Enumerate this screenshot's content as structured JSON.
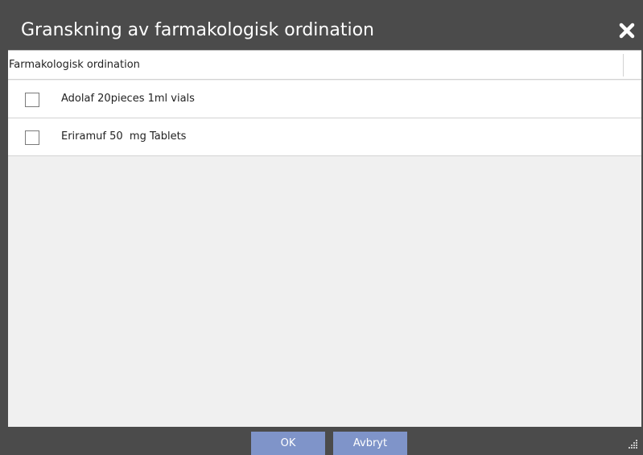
{
  "dialog": {
    "title": "Granskning av farmakologisk ordination",
    "close_icon": "close-icon"
  },
  "table": {
    "column_header": "Farmakologisk ordination",
    "rows": [
      {
        "label": "Adolaf 20pieces 1ml vials",
        "checked": false
      },
      {
        "label": "Eriramuf 50  mg Tablets",
        "checked": false
      }
    ]
  },
  "footer": {
    "ok_label": "OK",
    "cancel_label": "Avbryt",
    "resize_icon": "resize-grip-icon"
  },
  "colors": {
    "chrome": "#4b4b4b",
    "button": "#7f94c9",
    "content_bg": "#f0f0f0",
    "row_bg": "#ffffff"
  }
}
